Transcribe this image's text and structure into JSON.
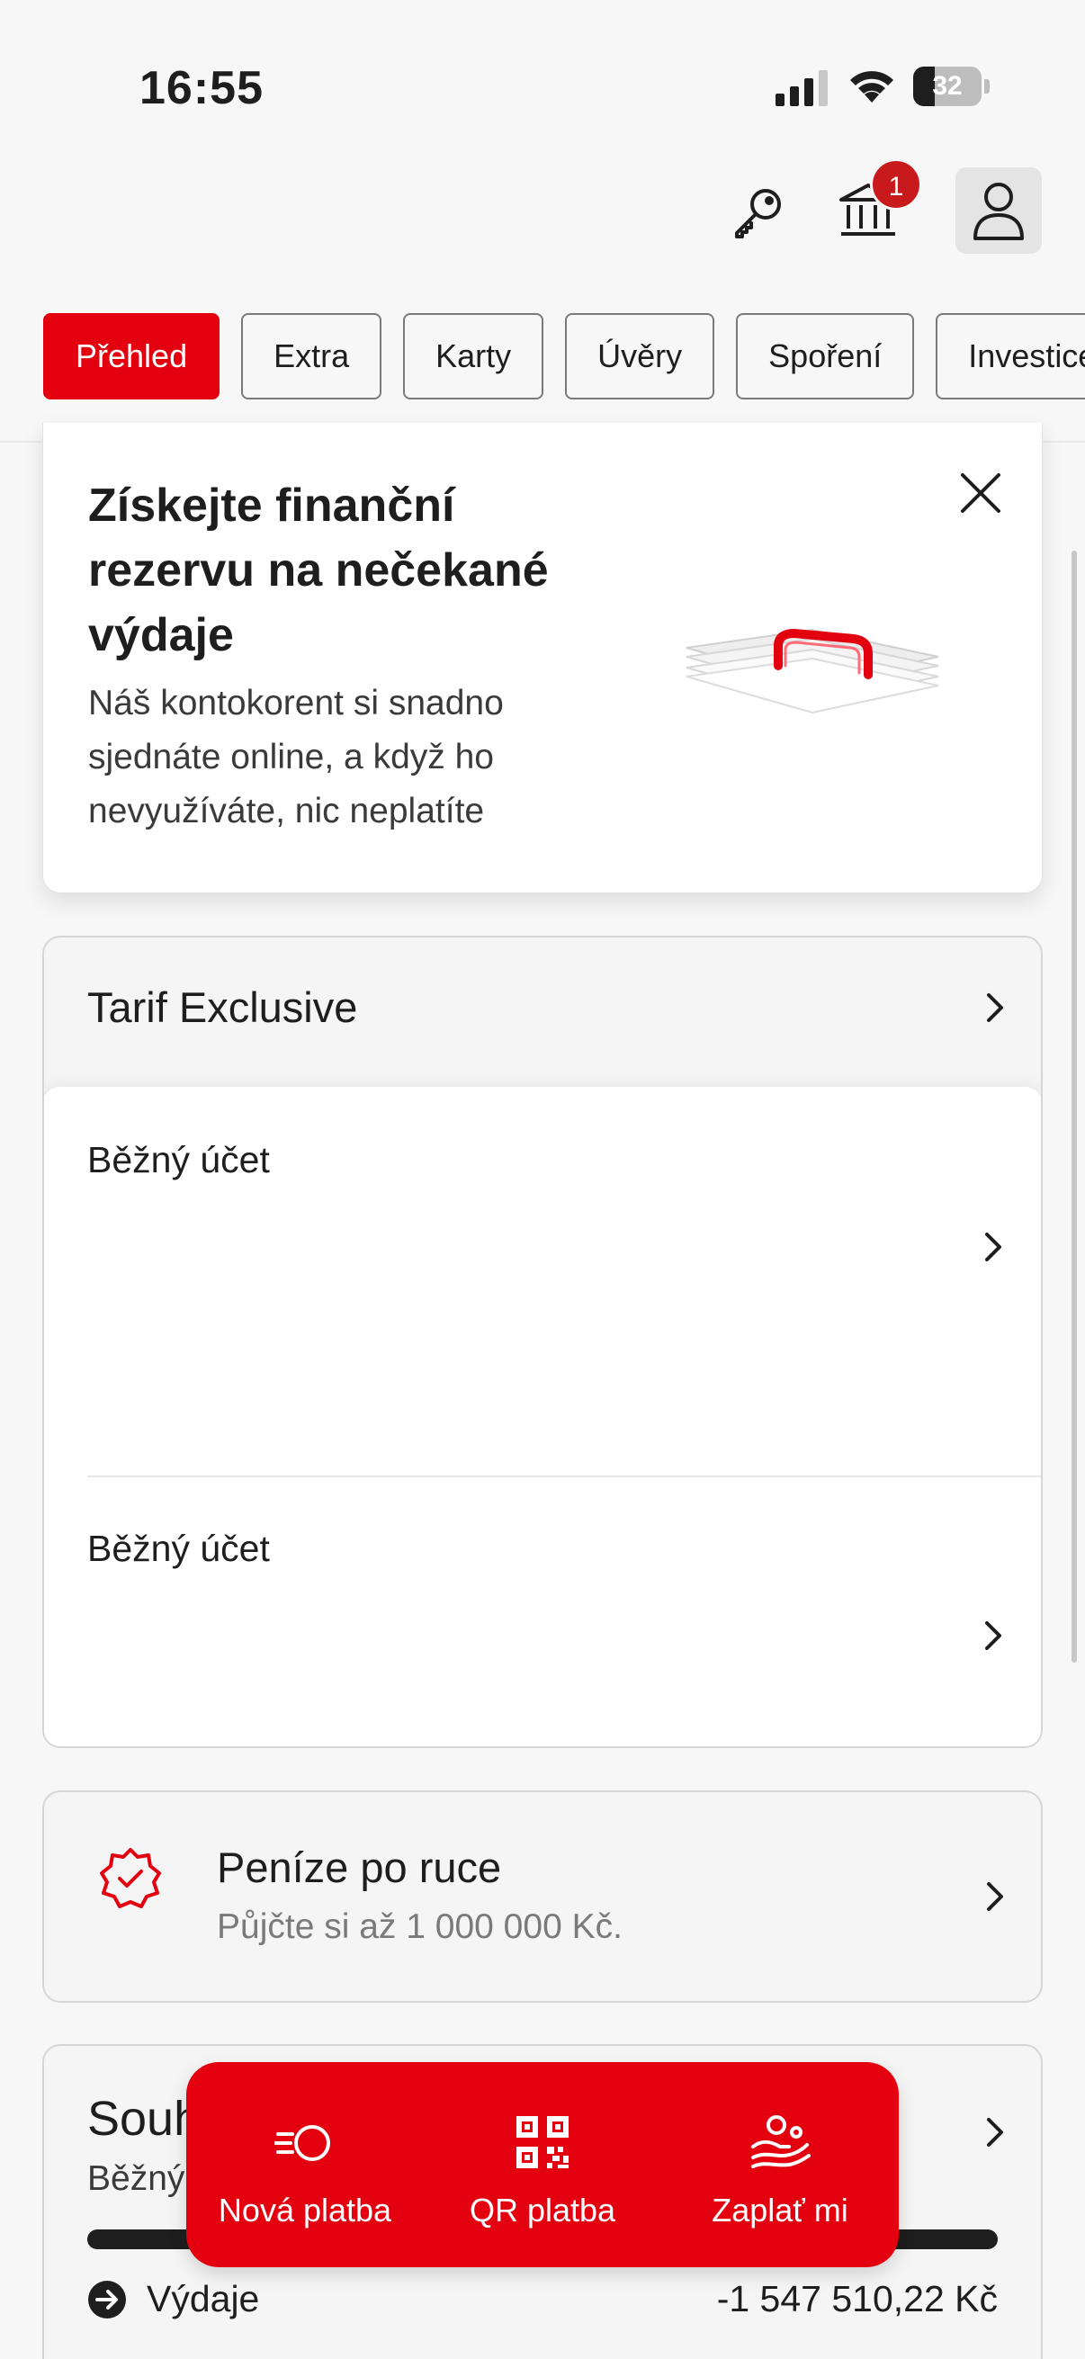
{
  "status_bar": {
    "time": "16:55",
    "battery": "32",
    "battery_level": 0.32
  },
  "header": {
    "notification_count": "1"
  },
  "tabs": [
    {
      "label": "Přehled",
      "active": true
    },
    {
      "label": "Extra",
      "active": false
    },
    {
      "label": "Karty",
      "active": false
    },
    {
      "label": "Úvěry",
      "active": false
    },
    {
      "label": "Spoření",
      "active": false
    },
    {
      "label": "Investice",
      "active": false
    }
  ],
  "promo": {
    "title": "Získejte finanční rezervu na nečekané výdaje",
    "text": "Náš kontokorent si snadno sjednáte online, a když ho nevyužíváte, nic neplatíte"
  },
  "tarif": {
    "title": "Tarif Exclusive",
    "accounts": [
      {
        "label": "Běžný účet"
      },
      {
        "label": "Běžný účet"
      }
    ]
  },
  "money_offer": {
    "title": "Peníze po ruce",
    "subtitle": "Půjčte si až 1 000 000 Kč."
  },
  "summary": {
    "title": "Souhrn",
    "subtitle": "Běžný účet",
    "expense_label": "Výdaje",
    "expense_amount": "-1 547 510,22 Kč",
    "expense_ratio": 1.0
  },
  "actions": {
    "new_payment": "Nová platba",
    "qr_payment": "QR platba",
    "pay_me": "Zaplať mi"
  },
  "colors": {
    "brand_red": "#e3000f",
    "badge_red": "#c8191d"
  }
}
